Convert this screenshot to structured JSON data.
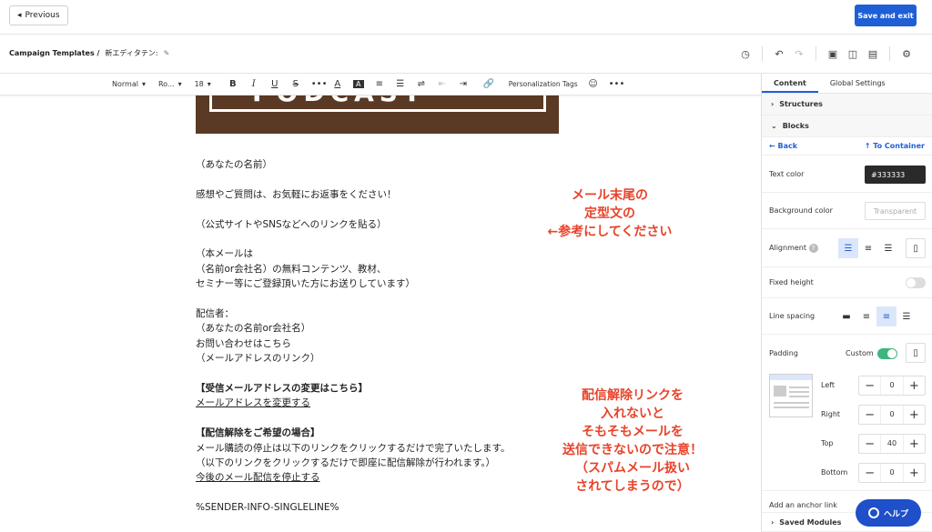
{
  "topbar": {
    "previous_label": "Previous",
    "save_label": "Save and exit"
  },
  "titlebar": {
    "breadcrumb_root": "Campaign Templates /",
    "template_name": "新エディタテン:"
  },
  "toolbar": {
    "style_select": "Normal",
    "font_select": "Ro...",
    "size_select": "18",
    "personalization": "Personalization Tags"
  },
  "email": {
    "body_lines": [
      "（あなたの名前）",
      "",
      "感想やご質問は、お気軽にお返事をください！",
      "",
      "（公式サイトやSNSなどへのリンクを貼る）",
      "",
      "（本メールは",
      "（名前or会社名）の無料コンテンツ、教材、",
      "セミナー等にご登録頂いた方にお送りしています）",
      "",
      "配信者：",
      "（あなたの名前or会社名）",
      "お問い合わせはこちら",
      "（メールアドレスのリンク）",
      "",
      "【受信メールアドレスの変更はこちら】",
      "メールアドレスを変更する",
      "",
      "【配信解除をご希望の場合】",
      "メール購読の停止は以下のリンクをクリックするだけで完了いたします。",
      "（以下のリンクをクリックするだけで即座に配信解除が行われます。）",
      "今後のメール配信を停止する",
      "",
      "%SENDER-INFO-SINGLELINE%"
    ]
  },
  "annotations": {
    "note1": [
      "メール末尾の",
      "定型文の",
      "←参考にしてください"
    ],
    "note2": [
      "配信解除リンクを",
      "入れないと",
      "そもそもメールを",
      "送信できないので注意！",
      "（スパムメール扱い",
      "されてしまうので）"
    ]
  },
  "panel": {
    "tabs": [
      "Content",
      "Global Settings"
    ],
    "structures": "Structures",
    "blocks": "Blocks",
    "back": "Back",
    "to_container": "To Container",
    "text_color_label": "Text color",
    "text_color_value": "#333333",
    "bg_color_label": "Background color",
    "bg_color_value": "Transparent",
    "alignment_label": "Alignment",
    "fixed_height_label": "Fixed height",
    "line_spacing_label": "Line spacing",
    "padding_label": "Padding",
    "padding_mode": "Custom",
    "padding": [
      {
        "side": "Left",
        "value": "0"
      },
      {
        "side": "Right",
        "value": "0"
      },
      {
        "side": "Top",
        "value": "40"
      },
      {
        "side": "Bottom",
        "value": "0"
      }
    ],
    "anchor_label": "Add an anchor link",
    "saved_modules": "Saved Modules"
  },
  "help": {
    "label": "ヘルプ"
  },
  "colors": {
    "accent": "#1f5fd6",
    "annotation": "#e8432a",
    "toggle_on": "#3fb67c"
  }
}
